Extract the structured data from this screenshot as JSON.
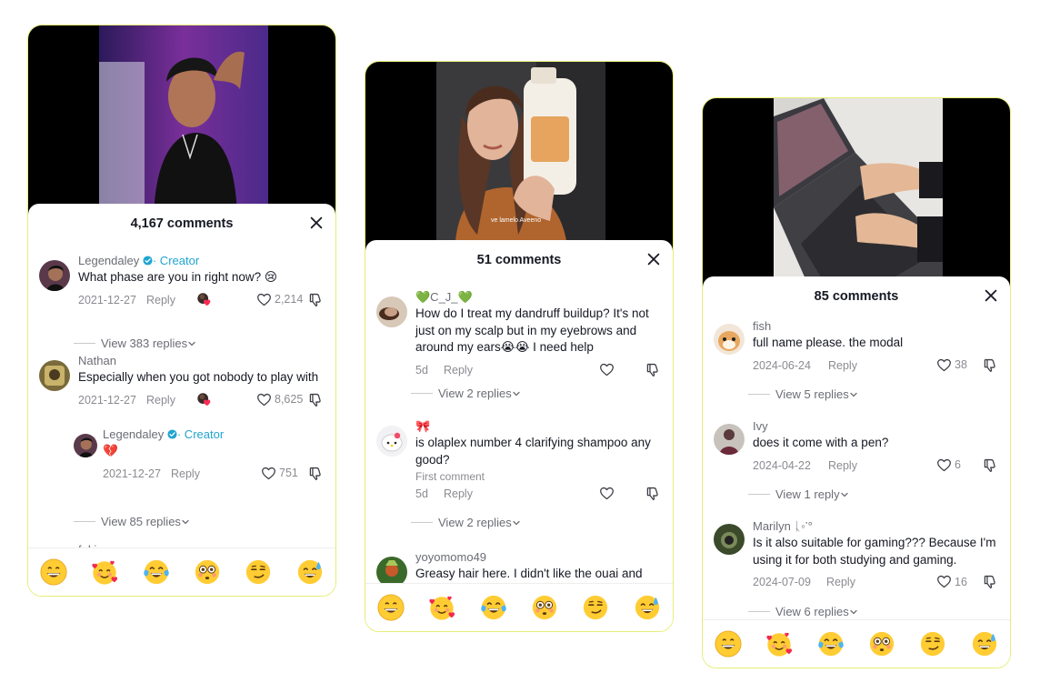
{
  "panels": [
    {
      "header": "4,167 comments",
      "comments": [
        {
          "user": "Legendaley",
          "creator_tag": "· Creator",
          "text": "What phase are you in right now? 😢",
          "date": "2021-12-27",
          "reply": "Reply",
          "likes": "2,214",
          "view_replies": "View 383 replies"
        },
        {
          "user": "Nathan",
          "text": "Especially when you got nobody to play with",
          "date": "2021-12-27",
          "reply": "Reply",
          "likes": "8,625"
        },
        {
          "user": "Legendaley",
          "creator_tag": "· Creator",
          "text": "💔",
          "date": "2021-12-27",
          "reply": "Reply",
          "likes": "751",
          "view_replies": "View 85 replies"
        },
        {
          "user": "fukipoo"
        }
      ]
    },
    {
      "header": "51 comments",
      "caption": "ve lamelo Aveeno",
      "comments": [
        {
          "user": "💚C_J_💚",
          "text": "How do I treat my dandruff buildup? It's not just on my scalp but in my eyebrows and around my ears😭😭 I need help",
          "date": "5d",
          "reply": "Reply",
          "view_replies": "View 2 replies"
        },
        {
          "user": "🎀",
          "text": "is olaplex number 4 clarifying shampoo any good?",
          "note": "First comment",
          "date": "5d",
          "reply": "Reply",
          "view_replies": "View 2 replies"
        },
        {
          "user": "yoyomomo49",
          "text": "Greasy hair here. I didn't like the ouai and"
        }
      ]
    },
    {
      "header": "85 comments",
      "comments": [
        {
          "user": "fish",
          "text": "full name please. the modal",
          "date": "2024-06-24",
          "reply": "Reply",
          "likes": "38",
          "view_replies": "View 5 replies"
        },
        {
          "user": "Ivy",
          "text": "does it come with a pen?",
          "date": "2024-04-22",
          "reply": "Reply",
          "likes": "6",
          "view_replies": "View 1 reply"
        },
        {
          "user": "Marilyn ᚳ◦་°",
          "text": "Is it also suitable for gaming??? Because I'm using it for both studying and gaming.",
          "date": "2024-07-09",
          "reply": "Reply",
          "likes": "16",
          "view_replies": "View 6 replies"
        }
      ]
    }
  ],
  "emoji_bar": [
    "grinning-face",
    "smiling-face-with-hearts",
    "tears-of-joy",
    "flushed-face",
    "smirking-face",
    "grinning-sweat"
  ],
  "colors": {
    "panel_border": "#e6ee78",
    "creator": "#20a5d0",
    "muted": "#8a8b91",
    "text": "#161823"
  }
}
